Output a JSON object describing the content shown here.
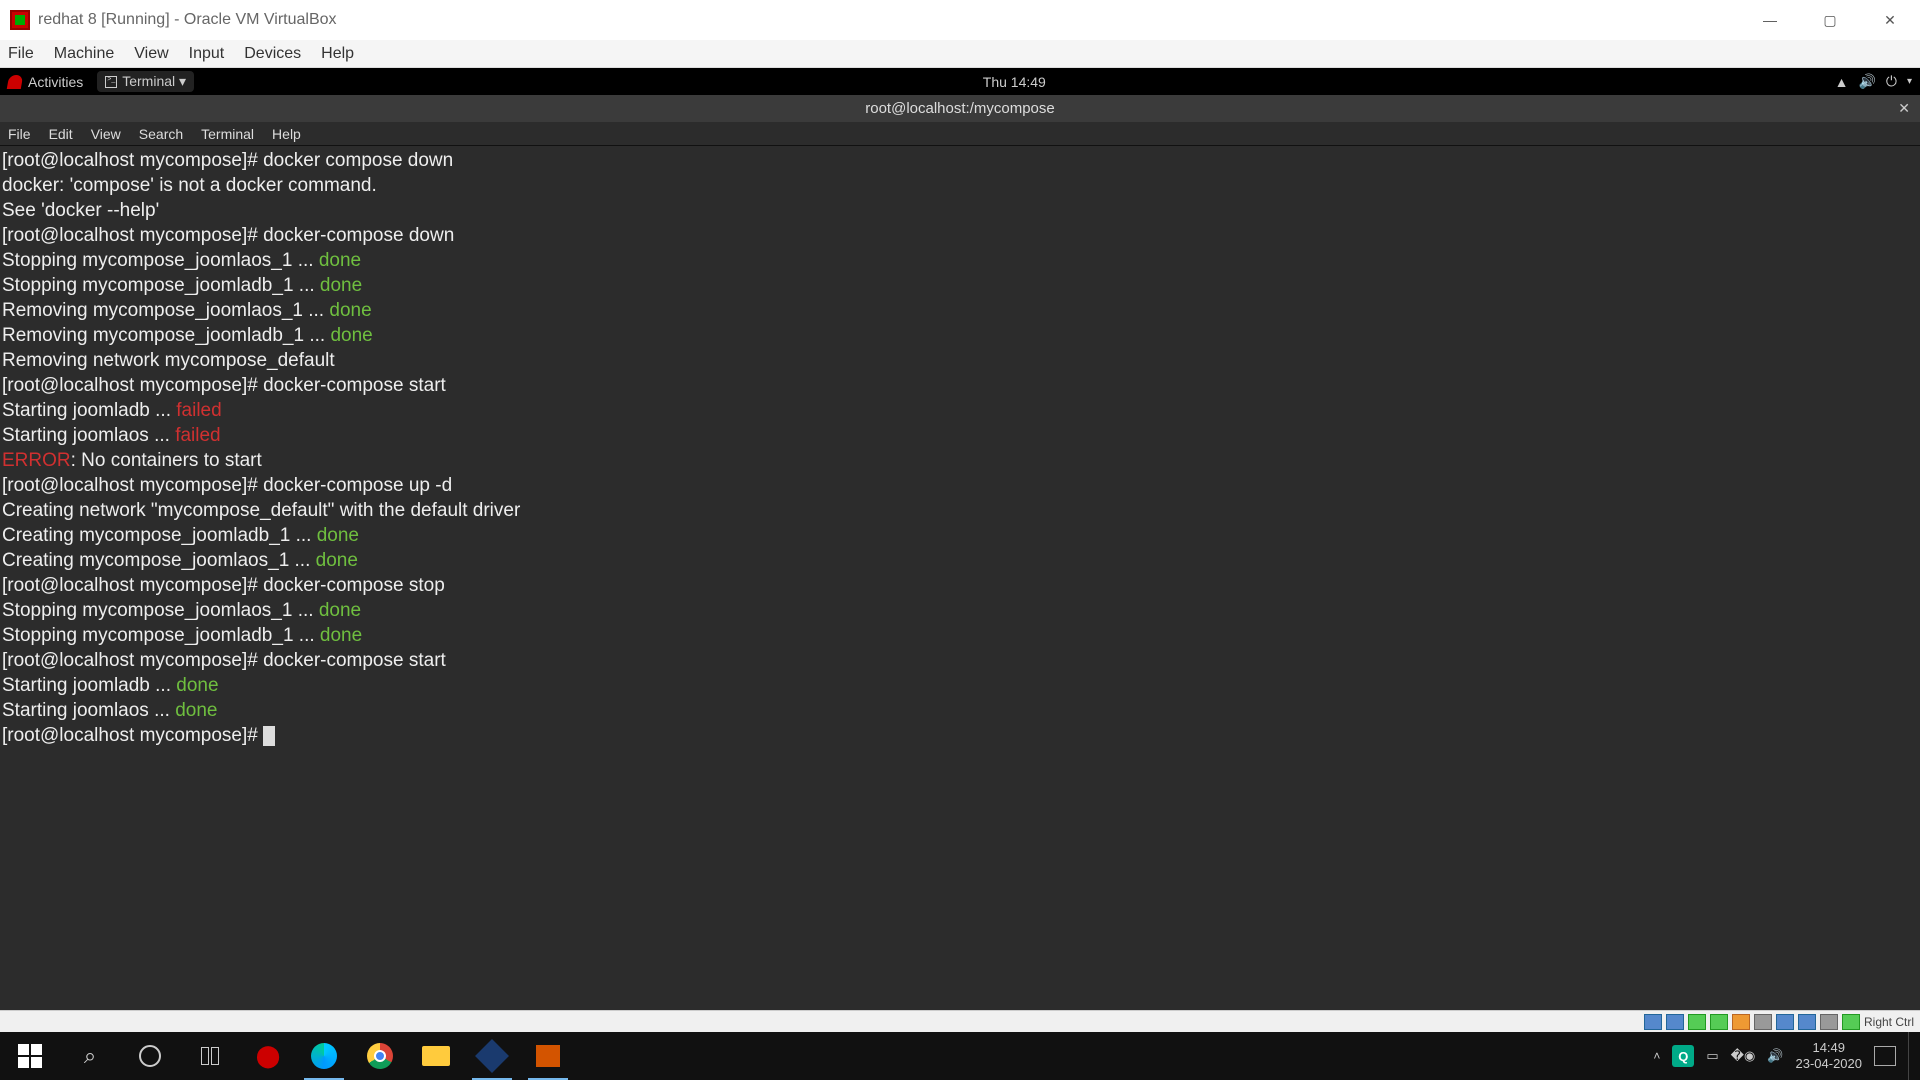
{
  "vbox": {
    "title": "redhat 8 [Running] - Oracle VM VirtualBox",
    "menu": [
      "File",
      "Machine",
      "View",
      "Input",
      "Devices",
      "Help"
    ],
    "statusHost": "Right Ctrl"
  },
  "gnome": {
    "activities": "Activities",
    "app": "Terminal ▾",
    "clock": "Thu 14:49",
    "trayCaret": "▾"
  },
  "termWindow": {
    "title": "root@localhost:/mycompose",
    "menu": [
      "File",
      "Edit",
      "View",
      "Search",
      "Terminal",
      "Help"
    ]
  },
  "terminal": {
    "lines": [
      {
        "segs": [
          {
            "t": "[root@localhost mycompose]# docker compose down"
          }
        ]
      },
      {
        "segs": [
          {
            "t": "docker: 'compose' is not a docker command."
          }
        ]
      },
      {
        "segs": [
          {
            "t": "See 'docker --help'"
          }
        ]
      },
      {
        "segs": [
          {
            "t": "[root@localhost mycompose]# docker-compose down"
          }
        ]
      },
      {
        "segs": [
          {
            "t": "Stopping mycompose_joomlaos_1 ... "
          },
          {
            "t": "done",
            "c": "green"
          }
        ]
      },
      {
        "segs": [
          {
            "t": "Stopping mycompose_joomladb_1 ... "
          },
          {
            "t": "done",
            "c": "green"
          }
        ]
      },
      {
        "segs": [
          {
            "t": "Removing mycompose_joomlaos_1 ... "
          },
          {
            "t": "done",
            "c": "green"
          }
        ]
      },
      {
        "segs": [
          {
            "t": "Removing mycompose_joomladb_1 ... "
          },
          {
            "t": "done",
            "c": "green"
          }
        ]
      },
      {
        "segs": [
          {
            "t": "Removing network mycompose_default"
          }
        ]
      },
      {
        "segs": [
          {
            "t": "[root@localhost mycompose]# docker-compose start"
          }
        ]
      },
      {
        "segs": [
          {
            "t": "Starting joomladb ... "
          },
          {
            "t": "failed",
            "c": "red"
          }
        ]
      },
      {
        "segs": [
          {
            "t": "Starting joomlaos ... "
          },
          {
            "t": "failed",
            "c": "red"
          }
        ]
      },
      {
        "segs": [
          {
            "t": "ERROR",
            "c": "red"
          },
          {
            "t": ": No containers to start"
          }
        ]
      },
      {
        "segs": [
          {
            "t": "[root@localhost mycompose]# docker-compose up -d"
          }
        ]
      },
      {
        "segs": [
          {
            "t": "Creating network \"mycompose_default\" with the default driver"
          }
        ]
      },
      {
        "segs": [
          {
            "t": "Creating mycompose_joomladb_1 ... "
          },
          {
            "t": "done",
            "c": "green"
          }
        ]
      },
      {
        "segs": [
          {
            "t": "Creating mycompose_joomlaos_1 ... "
          },
          {
            "t": "done",
            "c": "green"
          }
        ]
      },
      {
        "segs": [
          {
            "t": "[root@localhost mycompose]# docker-compose stop"
          }
        ]
      },
      {
        "segs": [
          {
            "t": "Stopping mycompose_joomlaos_1 ... "
          },
          {
            "t": "done",
            "c": "green"
          }
        ]
      },
      {
        "segs": [
          {
            "t": "Stopping mycompose_joomladb_1 ... "
          },
          {
            "t": "done",
            "c": "green"
          }
        ]
      },
      {
        "segs": [
          {
            "t": "[root@localhost mycompose]# docker-compose start"
          }
        ]
      },
      {
        "segs": [
          {
            "t": "Starting joomladb ... "
          },
          {
            "t": "done",
            "c": "green"
          }
        ]
      },
      {
        "segs": [
          {
            "t": "Starting joomlaos ... "
          },
          {
            "t": "done",
            "c": "green"
          }
        ]
      },
      {
        "segs": [
          {
            "t": "[root@localhost mycompose]# "
          }
        ],
        "cursor": true
      }
    ]
  },
  "taskbar": {
    "clock": {
      "time": "14:49",
      "date": "23-04-2020"
    },
    "searchGlyph": "⌕",
    "appsActive": [
      "edge",
      "chrome",
      "files",
      "vbox",
      "putty"
    ]
  }
}
